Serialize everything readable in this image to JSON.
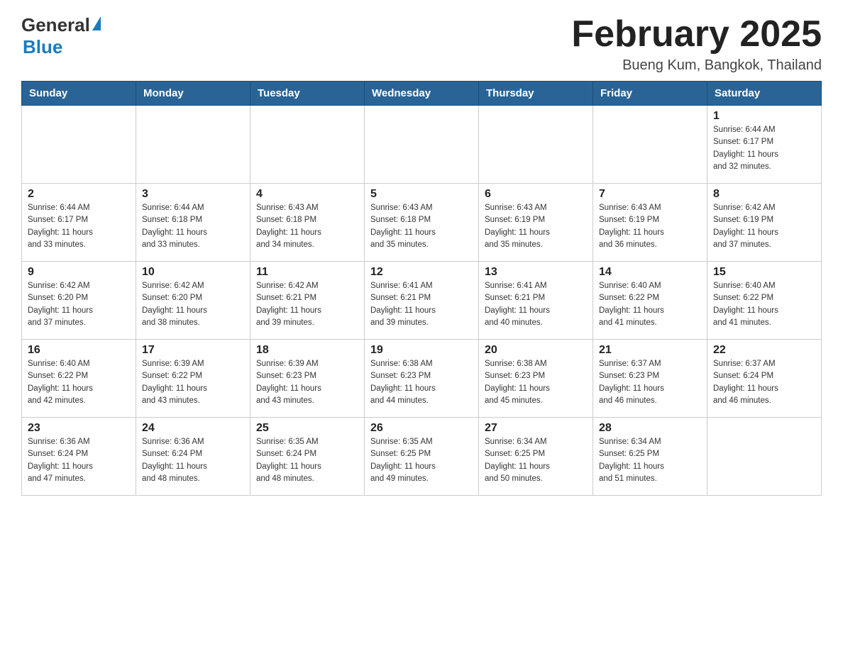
{
  "header": {
    "logo_general": "General",
    "logo_blue": "Blue",
    "main_title": "February 2025",
    "subtitle": "Bueng Kum, Bangkok, Thailand"
  },
  "days_of_week": [
    "Sunday",
    "Monday",
    "Tuesday",
    "Wednesday",
    "Thursday",
    "Friday",
    "Saturday"
  ],
  "weeks": [
    [
      {
        "day": "",
        "info": ""
      },
      {
        "day": "",
        "info": ""
      },
      {
        "day": "",
        "info": ""
      },
      {
        "day": "",
        "info": ""
      },
      {
        "day": "",
        "info": ""
      },
      {
        "day": "",
        "info": ""
      },
      {
        "day": "1",
        "info": "Sunrise: 6:44 AM\nSunset: 6:17 PM\nDaylight: 11 hours\nand 32 minutes."
      }
    ],
    [
      {
        "day": "2",
        "info": "Sunrise: 6:44 AM\nSunset: 6:17 PM\nDaylight: 11 hours\nand 33 minutes."
      },
      {
        "day": "3",
        "info": "Sunrise: 6:44 AM\nSunset: 6:18 PM\nDaylight: 11 hours\nand 33 minutes."
      },
      {
        "day": "4",
        "info": "Sunrise: 6:43 AM\nSunset: 6:18 PM\nDaylight: 11 hours\nand 34 minutes."
      },
      {
        "day": "5",
        "info": "Sunrise: 6:43 AM\nSunset: 6:18 PM\nDaylight: 11 hours\nand 35 minutes."
      },
      {
        "day": "6",
        "info": "Sunrise: 6:43 AM\nSunset: 6:19 PM\nDaylight: 11 hours\nand 35 minutes."
      },
      {
        "day": "7",
        "info": "Sunrise: 6:43 AM\nSunset: 6:19 PM\nDaylight: 11 hours\nand 36 minutes."
      },
      {
        "day": "8",
        "info": "Sunrise: 6:42 AM\nSunset: 6:19 PM\nDaylight: 11 hours\nand 37 minutes."
      }
    ],
    [
      {
        "day": "9",
        "info": "Sunrise: 6:42 AM\nSunset: 6:20 PM\nDaylight: 11 hours\nand 37 minutes."
      },
      {
        "day": "10",
        "info": "Sunrise: 6:42 AM\nSunset: 6:20 PM\nDaylight: 11 hours\nand 38 minutes."
      },
      {
        "day": "11",
        "info": "Sunrise: 6:42 AM\nSunset: 6:21 PM\nDaylight: 11 hours\nand 39 minutes."
      },
      {
        "day": "12",
        "info": "Sunrise: 6:41 AM\nSunset: 6:21 PM\nDaylight: 11 hours\nand 39 minutes."
      },
      {
        "day": "13",
        "info": "Sunrise: 6:41 AM\nSunset: 6:21 PM\nDaylight: 11 hours\nand 40 minutes."
      },
      {
        "day": "14",
        "info": "Sunrise: 6:40 AM\nSunset: 6:22 PM\nDaylight: 11 hours\nand 41 minutes."
      },
      {
        "day": "15",
        "info": "Sunrise: 6:40 AM\nSunset: 6:22 PM\nDaylight: 11 hours\nand 41 minutes."
      }
    ],
    [
      {
        "day": "16",
        "info": "Sunrise: 6:40 AM\nSunset: 6:22 PM\nDaylight: 11 hours\nand 42 minutes."
      },
      {
        "day": "17",
        "info": "Sunrise: 6:39 AM\nSunset: 6:22 PM\nDaylight: 11 hours\nand 43 minutes."
      },
      {
        "day": "18",
        "info": "Sunrise: 6:39 AM\nSunset: 6:23 PM\nDaylight: 11 hours\nand 43 minutes."
      },
      {
        "day": "19",
        "info": "Sunrise: 6:38 AM\nSunset: 6:23 PM\nDaylight: 11 hours\nand 44 minutes."
      },
      {
        "day": "20",
        "info": "Sunrise: 6:38 AM\nSunset: 6:23 PM\nDaylight: 11 hours\nand 45 minutes."
      },
      {
        "day": "21",
        "info": "Sunrise: 6:37 AM\nSunset: 6:23 PM\nDaylight: 11 hours\nand 46 minutes."
      },
      {
        "day": "22",
        "info": "Sunrise: 6:37 AM\nSunset: 6:24 PM\nDaylight: 11 hours\nand 46 minutes."
      }
    ],
    [
      {
        "day": "23",
        "info": "Sunrise: 6:36 AM\nSunset: 6:24 PM\nDaylight: 11 hours\nand 47 minutes."
      },
      {
        "day": "24",
        "info": "Sunrise: 6:36 AM\nSunset: 6:24 PM\nDaylight: 11 hours\nand 48 minutes."
      },
      {
        "day": "25",
        "info": "Sunrise: 6:35 AM\nSunset: 6:24 PM\nDaylight: 11 hours\nand 48 minutes."
      },
      {
        "day": "26",
        "info": "Sunrise: 6:35 AM\nSunset: 6:25 PM\nDaylight: 11 hours\nand 49 minutes."
      },
      {
        "day": "27",
        "info": "Sunrise: 6:34 AM\nSunset: 6:25 PM\nDaylight: 11 hours\nand 50 minutes."
      },
      {
        "day": "28",
        "info": "Sunrise: 6:34 AM\nSunset: 6:25 PM\nDaylight: 11 hours\nand 51 minutes."
      },
      {
        "day": "",
        "info": ""
      }
    ]
  ]
}
